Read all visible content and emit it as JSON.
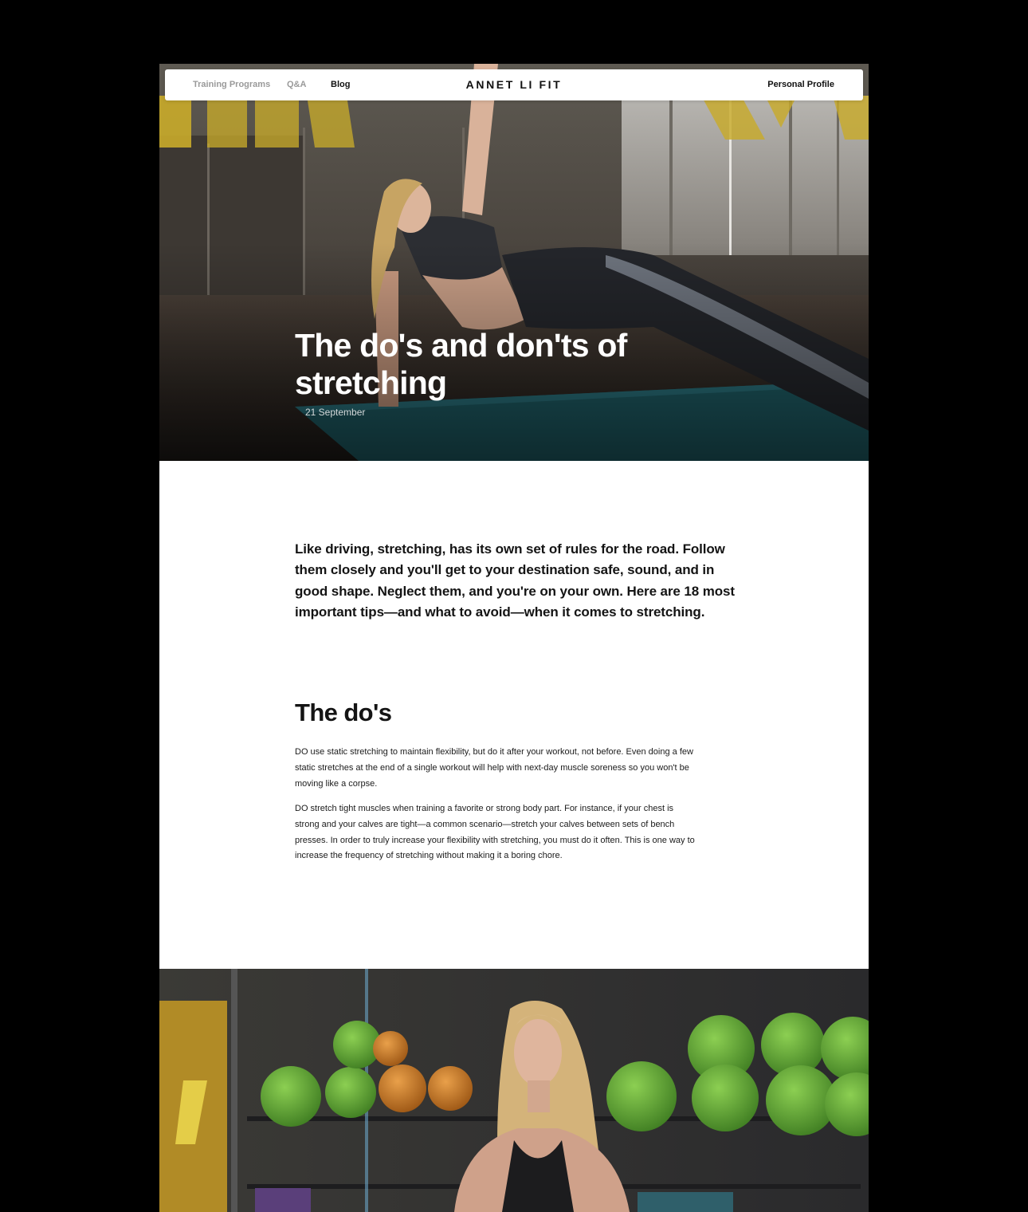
{
  "nav": {
    "links": [
      {
        "label": "Training Programs",
        "active": false
      },
      {
        "label": "Q&A",
        "active": false
      },
      {
        "label": "Blog",
        "active": true
      }
    ],
    "brand": "ANNET LI FIT",
    "profile_label": "Personal Profile"
  },
  "hero": {
    "title": "The do's and don'ts of stretching",
    "date": "21 September",
    "image_subject": "woman doing side plank stretch on teal mat in gym with mirrored wall"
  },
  "article": {
    "lead": "Like driving, stretching, has its own set of rules for the road. Follow them closely and you'll get to your destination safe, sound, and in good shape. Neglect them, and you're on your own. Here are 18 most important tips—and what to avoid—when it comes to stretching.",
    "section_heading": "The do's",
    "paragraphs": [
      "DO use static stretching to maintain flexibility, but do it after your workout, not before. Even doing a few static stretches at the end of a single workout will help with next-day muscle soreness so you won't be moving like a corpse.",
      "DO stretch tight muscles when training a favorite or strong body part. For instance, if your chest is strong and your calves are tight—a common scenario—stretch your calves between sets of bench presses. In order to truly increase your flexibility with stretching, you must do it often. This is one way to increase the frequency of stretching without making it a boring chore."
    ]
  },
  "bottom_image": {
    "subject": "blonde woman in black sports top in gym with green and orange exercise balls"
  },
  "colors": {
    "page_background": "#000000",
    "content_background": "#ffffff",
    "text_primary": "#141414",
    "nav_muted": "#9a9a9a",
    "accent_yellow": "#d8b82a",
    "mat_teal": "#1f5f67",
    "ball_green": "#6db33f",
    "ball_orange": "#d98a2b"
  }
}
